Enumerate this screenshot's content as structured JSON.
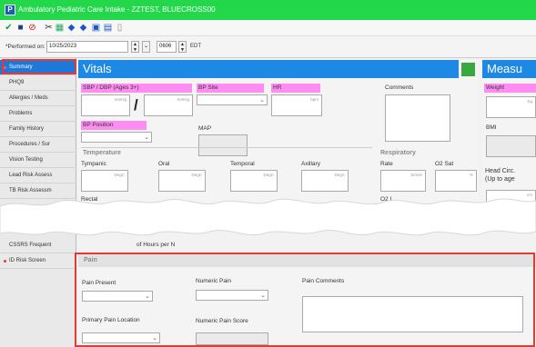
{
  "window": {
    "title": "Ambulatory Pediatric Care Intake - ZZTEST, BLUECROSS00"
  },
  "performed": {
    "label": "*Performed on:",
    "date": "10/25/2023",
    "time": "0606",
    "timezone": "EDT"
  },
  "nav": {
    "items_top": [
      "Summary",
      "PHQ9",
      "Allergies / Meds",
      "Problems",
      "Family History",
      "Procedures / Sur",
      "Vision Testing",
      "Lead Risk Assess",
      "TB Risk Assessm"
    ],
    "items_bottom": [
      "CSSRS Frequent",
      "ID Risk Screen"
    ]
  },
  "vitals": {
    "title": "Vitals",
    "bp_label": "SBP / DBP (Ages 3+)",
    "bp_unit1": "mmHg",
    "bp_unit2": "mmHg",
    "bp_slash": "/",
    "bp_site_label": "BP Site",
    "hr_label": "HR",
    "hr_unit": "bpm",
    "comments_label": "Comments",
    "bp_position_label": "BP Position",
    "map_label": "MAP",
    "temperature_label": "Temperature",
    "tympanic_label": "Tympanic",
    "oral_label": "Oral",
    "temporal_label": "Temporal",
    "axillary_label": "Axillary",
    "rectal_label": "Rectal",
    "temp_unit": "DegC",
    "respiratory_label": "Respiratory",
    "rate_label": "Rate",
    "rate_unit": "br/min",
    "o2sat_label": "O2 Sat",
    "o2sat_unit": "%",
    "o2_partial": "O2 L",
    "hours_partial": "of Hours per N"
  },
  "measurements": {
    "title": "Measu",
    "weight_label": "Weight",
    "weight_unit": "Kg",
    "bmi_label": "BMI",
    "head_circ_label": "Head Circ.",
    "head_circ_sub": "(Up to age",
    "head_unit": "cm"
  },
  "pain": {
    "title": "Pain",
    "present_label": "Pain Present",
    "numeric_label": "Numeric Pain",
    "comments_label": "Pain Comments",
    "location_label": "Primary Pain Location",
    "score_label": "Numeric Pain Score"
  },
  "colors": {
    "titlebar": "#22d84a",
    "header": "#1e88e5",
    "pink_label": "#ff8cf2",
    "highlight": "#e53935"
  }
}
